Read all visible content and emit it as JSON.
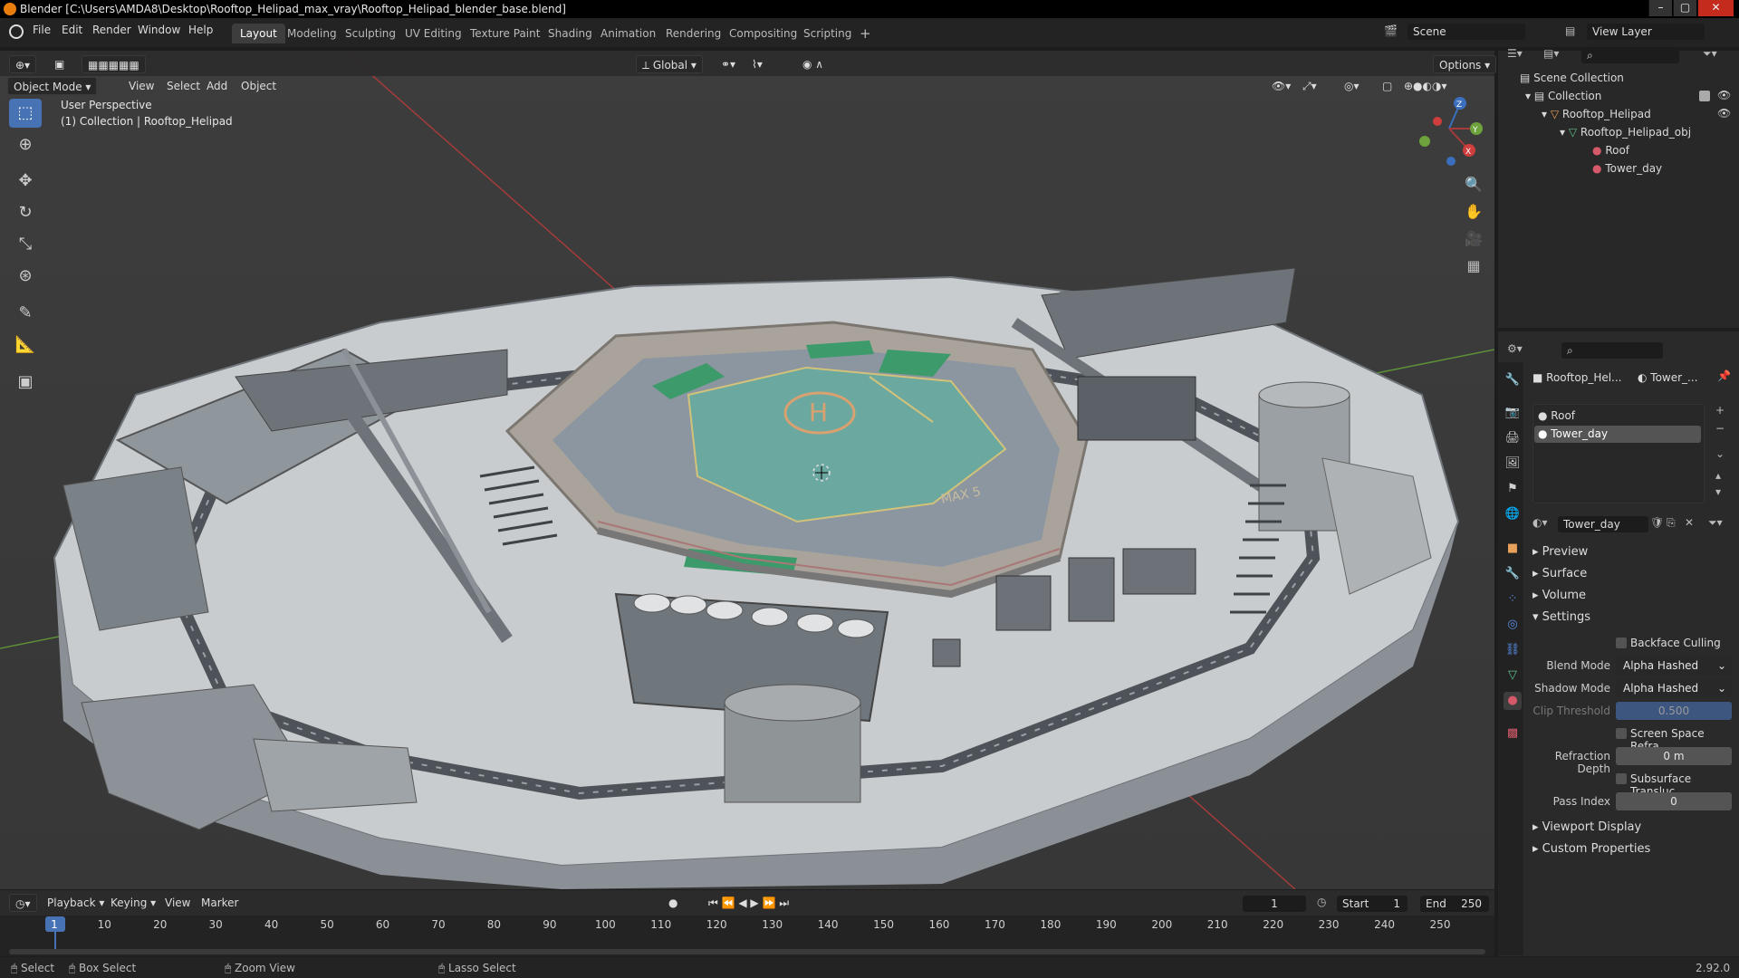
{
  "window": {
    "title": "Blender [C:\\Users\\AMDA8\\Desktop\\Rooftop_Helipad_max_vray\\Rooftop_Helipad_blender_base.blend]"
  },
  "menu": [
    "File",
    "Edit",
    "Render",
    "Window",
    "Help"
  ],
  "workspaces": [
    "Layout",
    "Modeling",
    "Sculpting",
    "UV Editing",
    "Texture Paint",
    "Shading",
    "Animation",
    "Rendering",
    "Compositing",
    "Scripting"
  ],
  "active_workspace": "Layout",
  "scene": {
    "name": "Scene",
    "view_layer": "View Layer"
  },
  "viewport_header": {
    "mode": "Object Mode",
    "menus": [
      "View",
      "Select",
      "Add",
      "Object"
    ],
    "transform": "Global",
    "options": "Options"
  },
  "viewport": {
    "perspective": "User Perspective",
    "collection_info": "(1) Collection | Rooftop_Helipad",
    "helipad_letter": "H",
    "helipad_mark": "MAX 5"
  },
  "outliner": {
    "items": [
      "Scene Collection",
      "Collection",
      "Rooftop_Helipad",
      "Rooftop_Helipad_obj",
      "Roof",
      "Tower_day"
    ]
  },
  "properties": {
    "object_name": "Rooftop_Hel...",
    "material_short": "Tower_...",
    "slots": [
      "Roof",
      "Tower_day"
    ],
    "active_material": "Tower_day",
    "sections": [
      "Preview",
      "Surface",
      "Volume",
      "Settings"
    ],
    "settings": {
      "backface_culling": "Backface Culling",
      "blend_mode_label": "Blend Mode",
      "blend_mode": "Alpha Hashed",
      "shadow_mode_label": "Shadow Mode",
      "shadow_mode": "Alpha Hashed",
      "clip_threshold_label": "Clip Threshold",
      "clip_threshold": "0.500",
      "screen_space": "Screen Space Refra...",
      "refraction_depth_label": "Refraction Depth",
      "refraction_depth": "0 m",
      "subsurface": "Subsurface Transluc...",
      "pass_index_label": "Pass Index",
      "pass_index": "0"
    },
    "footer_sections": [
      "Viewport Display",
      "Custom Properties"
    ]
  },
  "timeline": {
    "menus": [
      "Playback",
      "Keying",
      "View",
      "Marker"
    ],
    "current_frame": "1",
    "start_label": "Start",
    "start": "1",
    "end_label": "End",
    "end": "250",
    "ticks": [
      "1",
      "10",
      "20",
      "30",
      "40",
      "50",
      "60",
      "70",
      "80",
      "90",
      "100",
      "110",
      "120",
      "130",
      "140",
      "150",
      "160",
      "170",
      "180",
      "190",
      "200",
      "210",
      "220",
      "230",
      "240",
      "250"
    ]
  },
  "statusbar": {
    "select": "Select",
    "box_select": "Box Select",
    "zoom_view": "Zoom View",
    "lasso_select": "Lasso Select",
    "version": "2.92.0"
  },
  "colors": {
    "accent": "#4772b3",
    "orange": "#e87d0d",
    "helipad": "#6aa8a0",
    "green_pad": "#3d9a6a"
  }
}
